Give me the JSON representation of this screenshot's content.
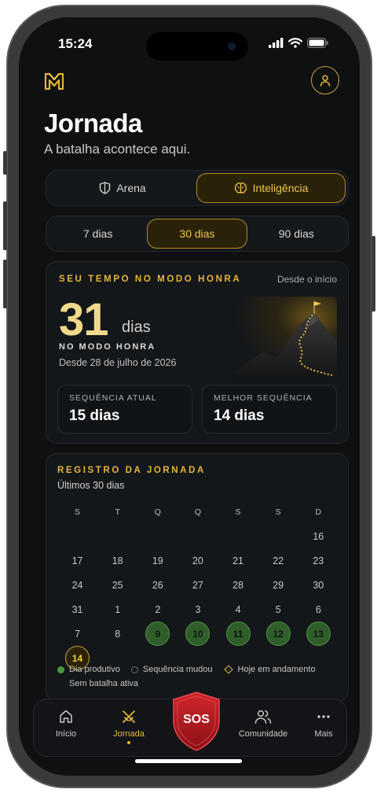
{
  "status": {
    "time": "15:24"
  },
  "header": {
    "title": "Jornada",
    "subtitle": "A batalha acontece aqui."
  },
  "main_tabs": [
    {
      "label": "Arena",
      "icon": "shield-icon",
      "active": false
    },
    {
      "label": "Inteligência",
      "icon": "brain-icon",
      "active": true
    }
  ],
  "periods": [
    {
      "label": "7 dias",
      "active": false
    },
    {
      "label": "30 dias",
      "active": true
    },
    {
      "label": "90 dias",
      "active": false
    }
  ],
  "honor_card": {
    "eyebrow": "SEU TEMPO NO MODO HONRA",
    "since_start": "Desde o início",
    "days_value": "31",
    "days_unit": "dias",
    "mode_label": "NO MODO HONRA",
    "since_date": "Desde 28 de julho de 2026",
    "current_streak_label": "SEQUÊNCIA ATUAL",
    "current_streak_value": "15 dias",
    "best_streak_label": "MELHOR SEQUÊNCIA",
    "best_streak_value": "14 dias"
  },
  "journal": {
    "eyebrow": "REGISTRO DA JORNADA",
    "subtitle": "Últimos 30 dias",
    "weekdays": [
      "S",
      "T",
      "Q",
      "Q",
      "S",
      "S",
      "D"
    ],
    "weeks": [
      [
        null,
        null,
        null,
        null,
        null,
        null,
        "16"
      ],
      [
        "17",
        "18",
        "19",
        "20",
        "21",
        "22",
        "23"
      ],
      [
        "24",
        "25",
        "26",
        "27",
        "28",
        "29",
        "30"
      ],
      [
        "31",
        "1",
        "2",
        "3",
        "4",
        "5",
        "6"
      ],
      [
        "7",
        "8",
        "9",
        "10",
        "11",
        "12",
        "13"
      ],
      [
        "14",
        null,
        null,
        null,
        null,
        null,
        null
      ]
    ],
    "productive_days": [
      "9",
      "10",
      "11",
      "12",
      "13"
    ],
    "today": "14",
    "legend": {
      "productive": "Dia produtivo",
      "streak_changed": "Sequência mudou",
      "today_in_progress": "Hoje em andamento",
      "no_battle": "Sem batalha ativa"
    }
  },
  "tabbar": {
    "home": "Início",
    "journey": "Jornada",
    "sos": "SOS",
    "community": "Comunidade",
    "more": "Mais"
  },
  "colors": {
    "accent": "#e3b53c",
    "productive": "#2f5e2b",
    "background": "#0e1012",
    "sos": "#b3161b"
  }
}
